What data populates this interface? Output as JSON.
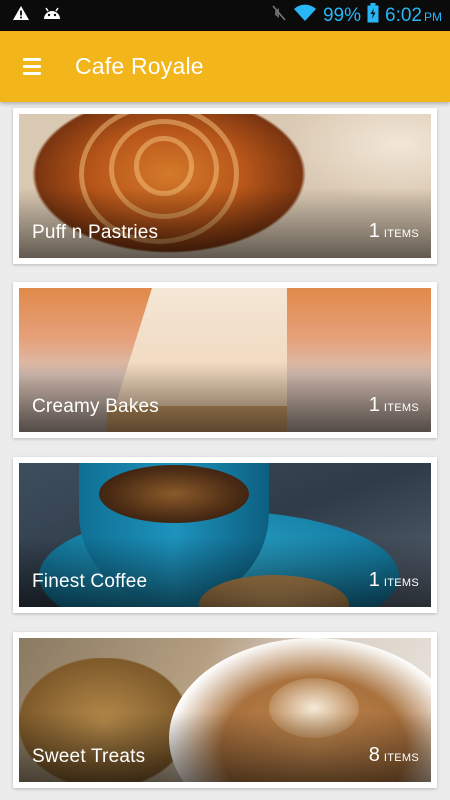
{
  "status_bar": {
    "battery": "99%",
    "time": "6:02",
    "ampm": "PM",
    "icons": [
      "warning-icon",
      "android-icon",
      "mute-icon",
      "wifi-icon",
      "battery-charging-icon"
    ]
  },
  "app_bar": {
    "menu_icon": "menu-icon",
    "title": "Cafe Royale"
  },
  "categories": [
    {
      "label": "Puff n Pastries",
      "count": "1",
      "unit": "ITEMS"
    },
    {
      "label": "Creamy Bakes",
      "count": "1",
      "unit": "ITEMS"
    },
    {
      "label": "Finest Coffee",
      "count": "1",
      "unit": "ITEMS"
    },
    {
      "label": "Sweet Treats",
      "count": "8",
      "unit": "ITEMS"
    }
  ],
  "colors": {
    "app_bar": "#f2b51a",
    "status_bar": "#0b0b0b",
    "status_icon": "#29b6f6",
    "background": "#ececec"
  }
}
